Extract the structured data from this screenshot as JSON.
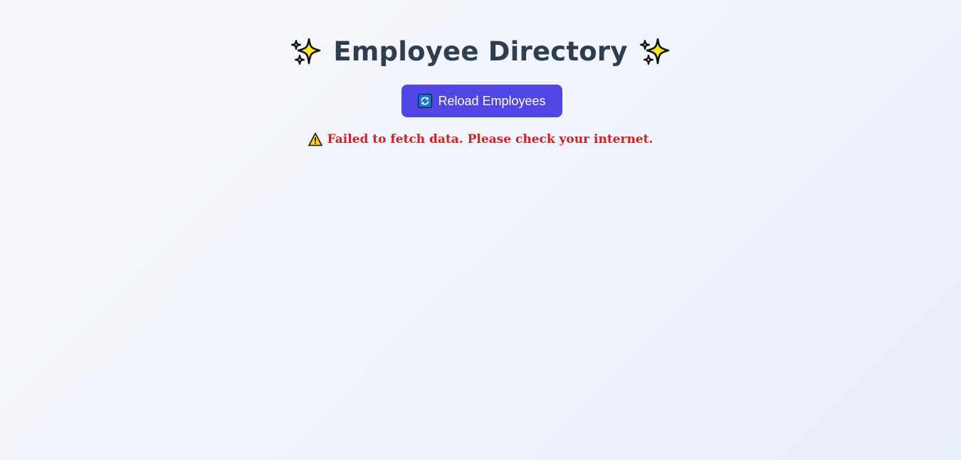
{
  "header": {
    "title": "Employee Directory",
    "left_icon": "sparkles-icon",
    "right_icon": "sparkles-icon"
  },
  "toolbar": {
    "reload_label": "Reload Employees",
    "reload_icon": "refresh-icon"
  },
  "status": {
    "error_message": "Failed to fetch data. Please check your internet.",
    "error_icon": "warning-icon"
  },
  "colors": {
    "title": "#2c3e50",
    "button_bg": "#4f46e5",
    "button_text": "#ffffff",
    "error": "#d61f1f",
    "background": "#f1f4fb"
  }
}
